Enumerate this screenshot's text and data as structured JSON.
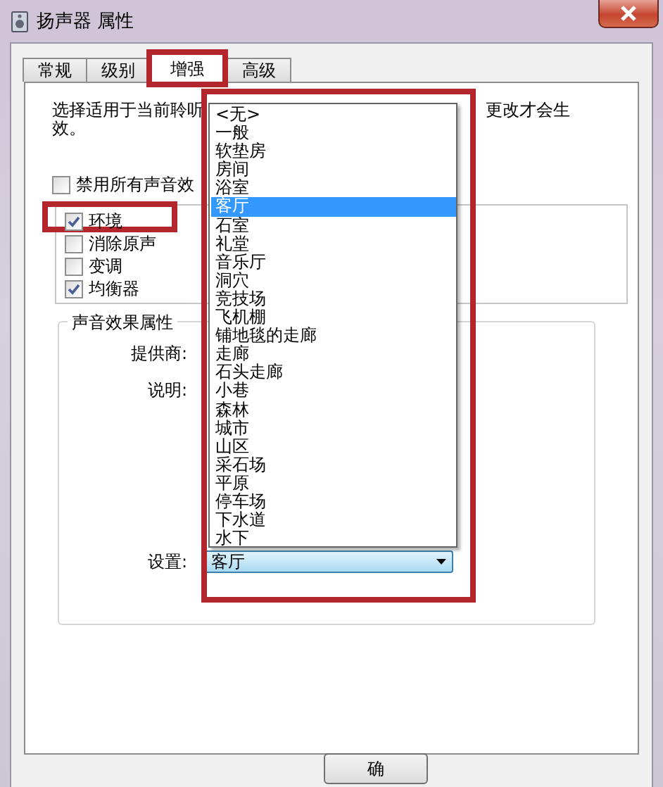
{
  "window": {
    "title": "扬声器 属性"
  },
  "tabs": [
    {
      "label": "常规",
      "selected": false,
      "highlighted": false
    },
    {
      "label": "级别",
      "selected": false,
      "highlighted": false
    },
    {
      "label": "增强",
      "selected": true,
      "highlighted": true
    },
    {
      "label": "高级",
      "selected": false,
      "highlighted": false
    }
  ],
  "description": {
    "line_1_start": "选择适用于当前聆听",
    "line_1_end": "更改才会生",
    "line_2": "效。"
  },
  "disable_all": {
    "label": "禁用所有声音效",
    "checked": false
  },
  "effects": [
    {
      "label": "环境",
      "checked": true,
      "highlighted": true
    },
    {
      "label": "消除原声",
      "checked": false,
      "highlighted": false
    },
    {
      "label": "变调",
      "checked": false,
      "highlighted": false
    },
    {
      "label": "均衡器",
      "checked": true,
      "highlighted": false
    }
  ],
  "properties": {
    "title": "声音效果属性",
    "provider_label": "提供商:",
    "description_label": "说明:",
    "settings_label": "设置:",
    "setting_value": "客厅"
  },
  "dropdown": {
    "open": true,
    "highlighted": true,
    "items": [
      {
        "label": "<无>",
        "selected": false
      },
      {
        "label": "一般",
        "selected": false
      },
      {
        "label": "软垫房",
        "selected": false
      },
      {
        "label": "房间",
        "selected": false
      },
      {
        "label": "浴室",
        "selected": false
      },
      {
        "label": "客厅",
        "selected": true
      },
      {
        "label": "石室",
        "selected": false
      },
      {
        "label": "礼堂",
        "selected": false
      },
      {
        "label": "音乐厅",
        "selected": false
      },
      {
        "label": "洞穴",
        "selected": false
      },
      {
        "label": "竞技场",
        "selected": false
      },
      {
        "label": "飞机棚",
        "selected": false
      },
      {
        "label": "铺地毯的走廊",
        "selected": false
      },
      {
        "label": "走廊",
        "selected": false
      },
      {
        "label": "石头走廊",
        "selected": false
      },
      {
        "label": "小巷",
        "selected": false
      },
      {
        "label": "森林",
        "selected": false
      },
      {
        "label": "城市",
        "selected": false
      },
      {
        "label": "山区",
        "selected": false
      },
      {
        "label": "采石场",
        "selected": false
      },
      {
        "label": "平原",
        "selected": false
      },
      {
        "label": "停车场",
        "selected": false
      },
      {
        "label": "下水道",
        "selected": false
      },
      {
        "label": "水下",
        "selected": false
      }
    ]
  },
  "buttons": [
    {
      "label": "确"
    }
  ]
}
